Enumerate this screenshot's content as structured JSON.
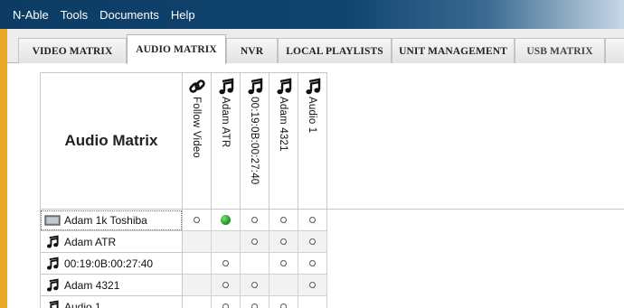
{
  "menu": [
    "N-Able",
    "Tools",
    "Documents",
    "Help"
  ],
  "tabs": [
    "VIDEO MATRIX",
    "AUDIO MATRIX",
    "NVR",
    "LOCAL PLAYLISTS",
    "UNIT MANAGEMENT",
    "USB MATRIX"
  ],
  "active_tab": "AUDIO MATRIX",
  "matrix": {
    "title": "Audio Matrix",
    "columns": [
      {
        "label": "Follow Video",
        "icon": "link-icon"
      },
      {
        "label": "Adam ATR",
        "icon": "music-note-icon"
      },
      {
        "label": "00:19:0B:00:27:40",
        "icon": "music-note-icon"
      },
      {
        "label": "Adam 4321",
        "icon": "music-note-icon"
      },
      {
        "label": "Audio 1",
        "icon": "music-note-icon"
      }
    ],
    "rows": [
      {
        "label": "Adam 1k Toshiba",
        "icon": "monitor-icon",
        "cells": [
          "off",
          "on",
          "off",
          "off",
          "off"
        ]
      },
      {
        "label": "Adam ATR",
        "icon": "music-note-icon",
        "cells": [
          "",
          "",
          "off",
          "off",
          "off"
        ]
      },
      {
        "label": "00:19:0B:00:27:40",
        "icon": "music-note-icon",
        "cells": [
          "",
          "off",
          "",
          "off",
          "off"
        ]
      },
      {
        "label": "Adam 4321",
        "icon": "music-note-icon",
        "cells": [
          "",
          "off",
          "off",
          "",
          "off"
        ]
      },
      {
        "label": "Audio 1",
        "icon": "music-note-icon",
        "cells": [
          "",
          "off",
          "off",
          "off",
          ""
        ]
      }
    ]
  },
  "colors": {
    "menubar": "#0f446f",
    "frame": "#eba72a",
    "active_dot": "#1f9a2a"
  }
}
